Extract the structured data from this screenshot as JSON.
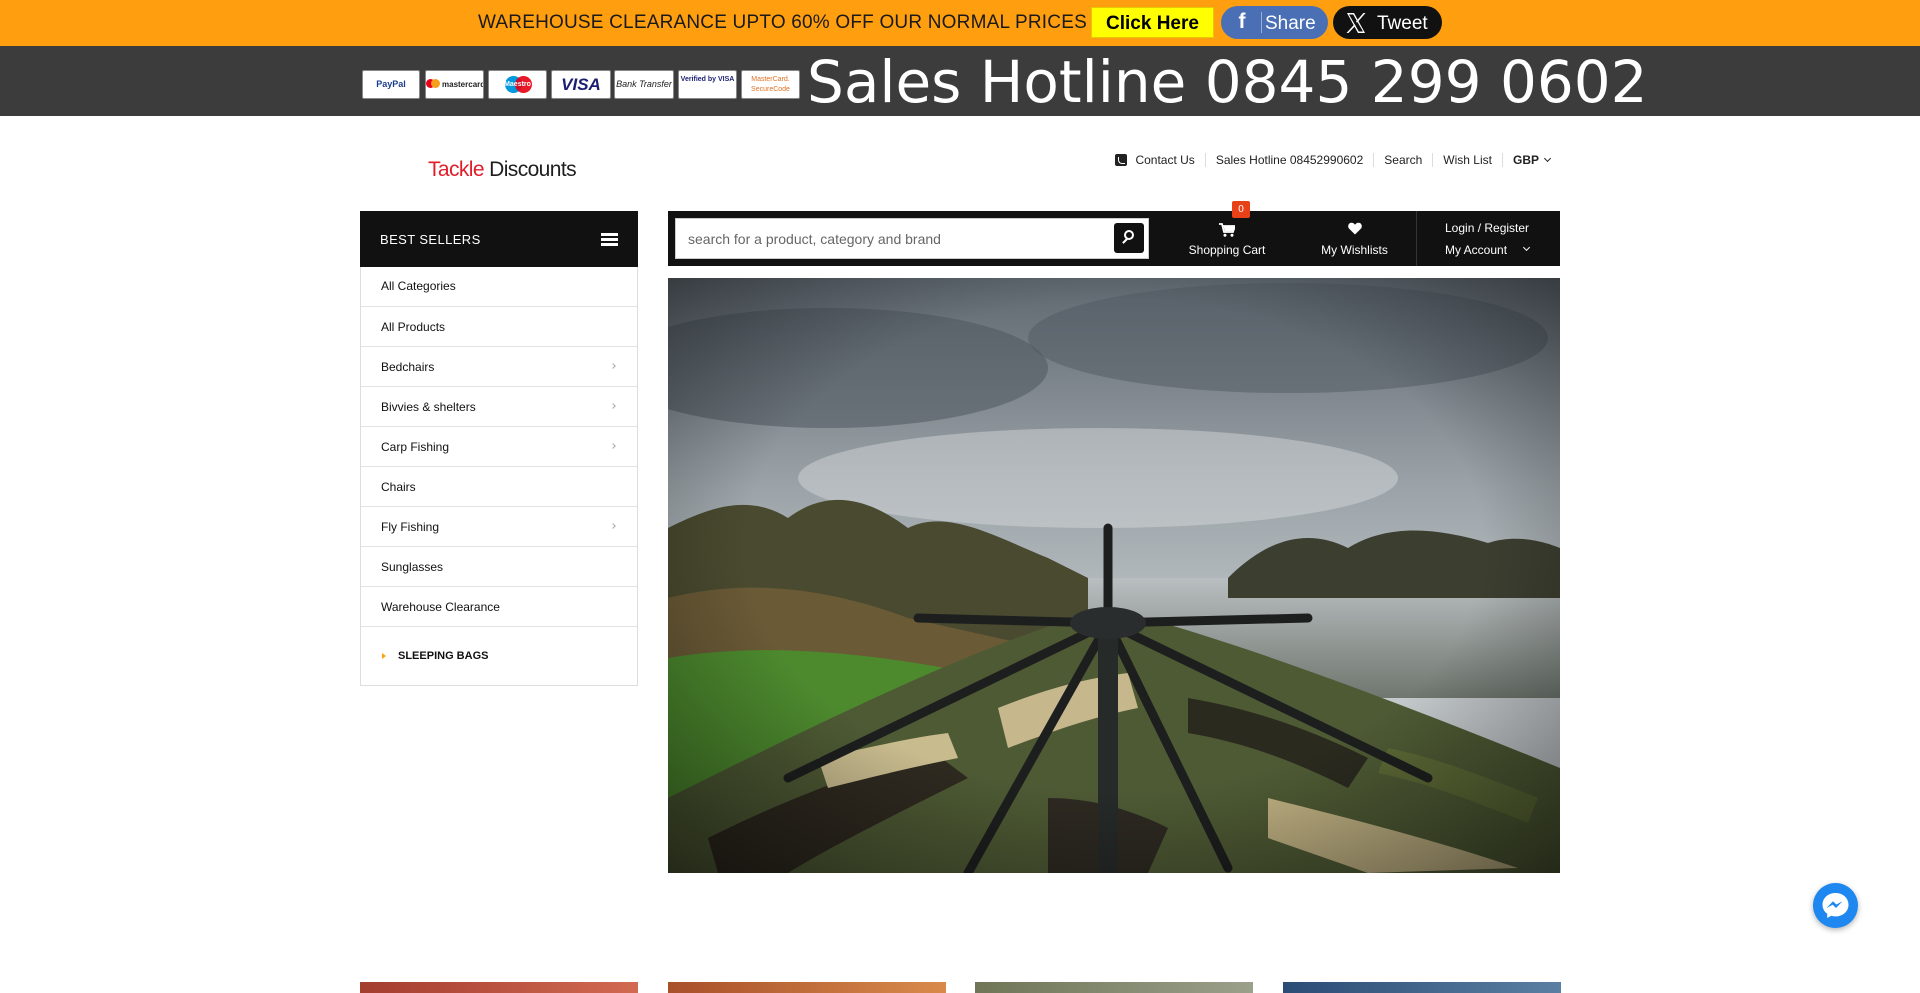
{
  "promo": {
    "text": "WAREHOUSE CLEARANCE UPTO 60% OFF OUR NORMAL PRICES",
    "cta": "Click Here",
    "share_label": "Share",
    "tweet_label": "Tweet",
    "share_icon": "facebook-icon",
    "tweet_icon": "x-icon",
    "bar_color": "#ff9f0f",
    "cta_color": "#ffff00"
  },
  "payment_methods": [
    "PayPal",
    "mastercard",
    "Maestro",
    "VISA",
    "Bank Transfer",
    "Verified by VISA",
    "MasterCard. SecureCode"
  ],
  "hotline_banner": "Sales Hotline 0845 299 0602",
  "logo": {
    "part1": "Tackle",
    "part2": " Discounts"
  },
  "top_links": {
    "contact": "Contact Us",
    "hotline": "Sales Hotline 08452990602",
    "search": "Search",
    "wishlist": "Wish List",
    "currency": "GBP"
  },
  "sidebar": {
    "heading": "BEST SELLERS",
    "items": [
      {
        "label": "All Categories"
      },
      {
        "label": "All Products"
      },
      {
        "label": "Bedchairs"
      },
      {
        "label": "Bivvies & shelters"
      },
      {
        "label": "Carp Fishing"
      },
      {
        "label": "Chairs"
      },
      {
        "label": "Fly Fishing"
      },
      {
        "label": "Sunglasses"
      },
      {
        "label": "Warehouse Clearance"
      }
    ],
    "special": "SLEEPING BAGS"
  },
  "search": {
    "placeholder": "search for a product, category and brand"
  },
  "cart": {
    "label": "Shopping Cart",
    "count": "0"
  },
  "wishlists": {
    "label": "My Wishlists"
  },
  "account": {
    "login": "Login / Register",
    "my_account": "My Account"
  },
  "icons": {
    "cart": "shopping-cart-icon",
    "heart": "heart-icon",
    "search": "search-icon",
    "menu": "hamburger-menu-icon",
    "phone": "phone-icon",
    "messenger": "messenger-icon"
  },
  "hero": {
    "image": "camouflage carp-fishing brolly over a lake under a cloudy sky"
  }
}
